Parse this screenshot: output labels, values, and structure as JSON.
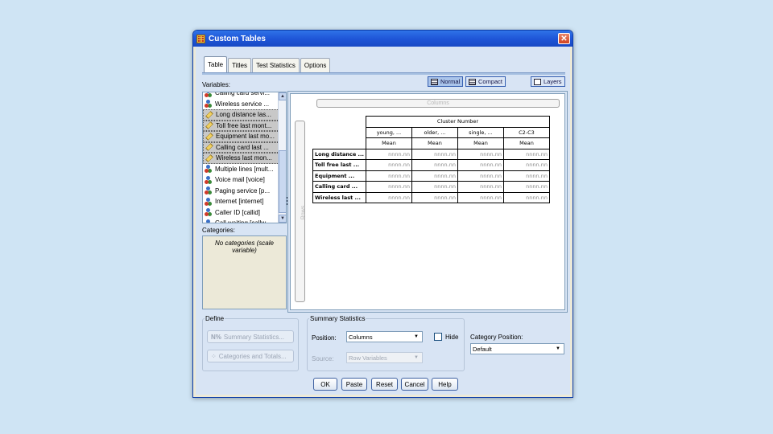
{
  "window": {
    "title": "Custom Tables"
  },
  "tabs": [
    {
      "label": "Table"
    },
    {
      "label": "Titles"
    },
    {
      "label": "Test Statistics"
    },
    {
      "label": "Options"
    }
  ],
  "variables_label": "Variables:",
  "variables": [
    {
      "label": "Calling card servi...",
      "icon": "nominal-icon"
    },
    {
      "label": "Wireless service ...",
      "icon": "nominal-icon"
    },
    {
      "label": "Long distance las...",
      "icon": "scale-icon"
    },
    {
      "label": "Toll free last mont...",
      "icon": "scale-icon"
    },
    {
      "label": "Equipment last mo...",
      "icon": "scale-icon"
    },
    {
      "label": "Calling card last ...",
      "icon": "scale-icon"
    },
    {
      "label": "Wireless last mon...",
      "icon": "scale-icon"
    },
    {
      "label": "Multiple lines [mult...",
      "icon": "nominal-icon"
    },
    {
      "label": "Voice mail [voice]",
      "icon": "nominal-icon"
    },
    {
      "label": "Paging service [p...",
      "icon": "nominal-icon"
    },
    {
      "label": "Internet [internet]",
      "icon": "nominal-icon"
    },
    {
      "label": "Caller ID [callid]",
      "icon": "nominal-icon"
    },
    {
      "label": "Call waiting [callw...",
      "icon": "nominal-icon"
    }
  ],
  "categories_label": "Categories:",
  "categories_note": "No categories (scale variable)",
  "view": {
    "normal": "Normal",
    "compact": "Compact",
    "layers": "Layers"
  },
  "canvas": {
    "columns_label": "Columns",
    "rows_label": "Rows",
    "cluster_header": "Cluster Number",
    "col_heads": [
      "young, ...",
      "older, ...",
      "single, ...",
      "C2-C3"
    ],
    "stat_label": "Mean",
    "rows": [
      "Long distance ...",
      "Toll free last ...",
      "Equipment ...",
      "Calling card ...",
      "Wireless last ..."
    ],
    "cell_value": "nnnn.nn"
  },
  "define": {
    "legend": "Define",
    "summary_btn": "Summary Statistics...",
    "categories_btn": "Categories and Totals..."
  },
  "summary": {
    "legend": "Summary Statistics",
    "position_label": "Position:",
    "position_value": "Columns",
    "hide_label": "Hide",
    "source_label": "Source:",
    "source_value": "Row Variables"
  },
  "category_position": {
    "label": "Category Position:",
    "value": "Default"
  },
  "buttons": {
    "ok": "OK",
    "paste": "Paste",
    "reset": "Reset",
    "cancel": "Cancel",
    "help": "Help"
  }
}
